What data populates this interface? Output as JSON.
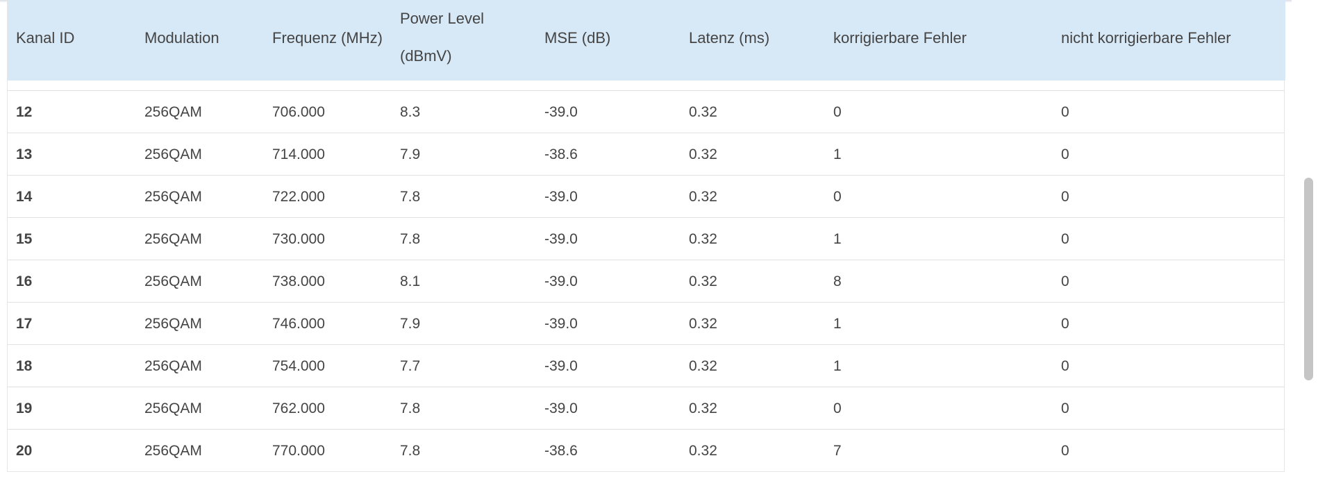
{
  "table": {
    "headers": {
      "kanal_id": "Kanal ID",
      "modulation": "Modulation",
      "frequenz": "Frequenz (MHz)",
      "power_level_line1": "Power Level",
      "power_level_line2": "(dBmV)",
      "mse": "MSE (dB)",
      "latenz": "Latenz (ms)",
      "korrigierbare": "korrigierbare Fehler",
      "nicht_korrigierbare": "nicht korrigierbare Fehler"
    },
    "rows": [
      {
        "id": "12",
        "modulation": "256QAM",
        "frequenz": "706.000",
        "power": "8.3",
        "mse": "-39.0",
        "latenz": "0.32",
        "korr": "0",
        "nicht_korr": "0"
      },
      {
        "id": "13",
        "modulation": "256QAM",
        "frequenz": "714.000",
        "power": "7.9",
        "mse": "-38.6",
        "latenz": "0.32",
        "korr": "1",
        "nicht_korr": "0"
      },
      {
        "id": "14",
        "modulation": "256QAM",
        "frequenz": "722.000",
        "power": "7.8",
        "mse": "-39.0",
        "latenz": "0.32",
        "korr": "0",
        "nicht_korr": "0"
      },
      {
        "id": "15",
        "modulation": "256QAM",
        "frequenz": "730.000",
        "power": "7.8",
        "mse": "-39.0",
        "latenz": "0.32",
        "korr": "1",
        "nicht_korr": "0"
      },
      {
        "id": "16",
        "modulation": "256QAM",
        "frequenz": "738.000",
        "power": "8.1",
        "mse": "-39.0",
        "latenz": "0.32",
        "korr": "8",
        "nicht_korr": "0"
      },
      {
        "id": "17",
        "modulation": "256QAM",
        "frequenz": "746.000",
        "power": "7.9",
        "mse": "-39.0",
        "latenz": "0.32",
        "korr": "1",
        "nicht_korr": "0"
      },
      {
        "id": "18",
        "modulation": "256QAM",
        "frequenz": "754.000",
        "power": "7.7",
        "mse": "-39.0",
        "latenz": "0.32",
        "korr": "1",
        "nicht_korr": "0"
      },
      {
        "id": "19",
        "modulation": "256QAM",
        "frequenz": "762.000",
        "power": "7.8",
        "mse": "-39.0",
        "latenz": "0.32",
        "korr": "0",
        "nicht_korr": "0"
      },
      {
        "id": "20",
        "modulation": "256QAM",
        "frequenz": "770.000",
        "power": "7.8",
        "mse": "-38.6",
        "latenz": "0.32",
        "korr": "7",
        "nicht_korr": "0"
      }
    ]
  },
  "colors": {
    "header_bg": "#d7e8f6",
    "text": "#444444",
    "row_border": "#e2e2e2",
    "scrollbar_thumb": "#c5c5c5"
  }
}
